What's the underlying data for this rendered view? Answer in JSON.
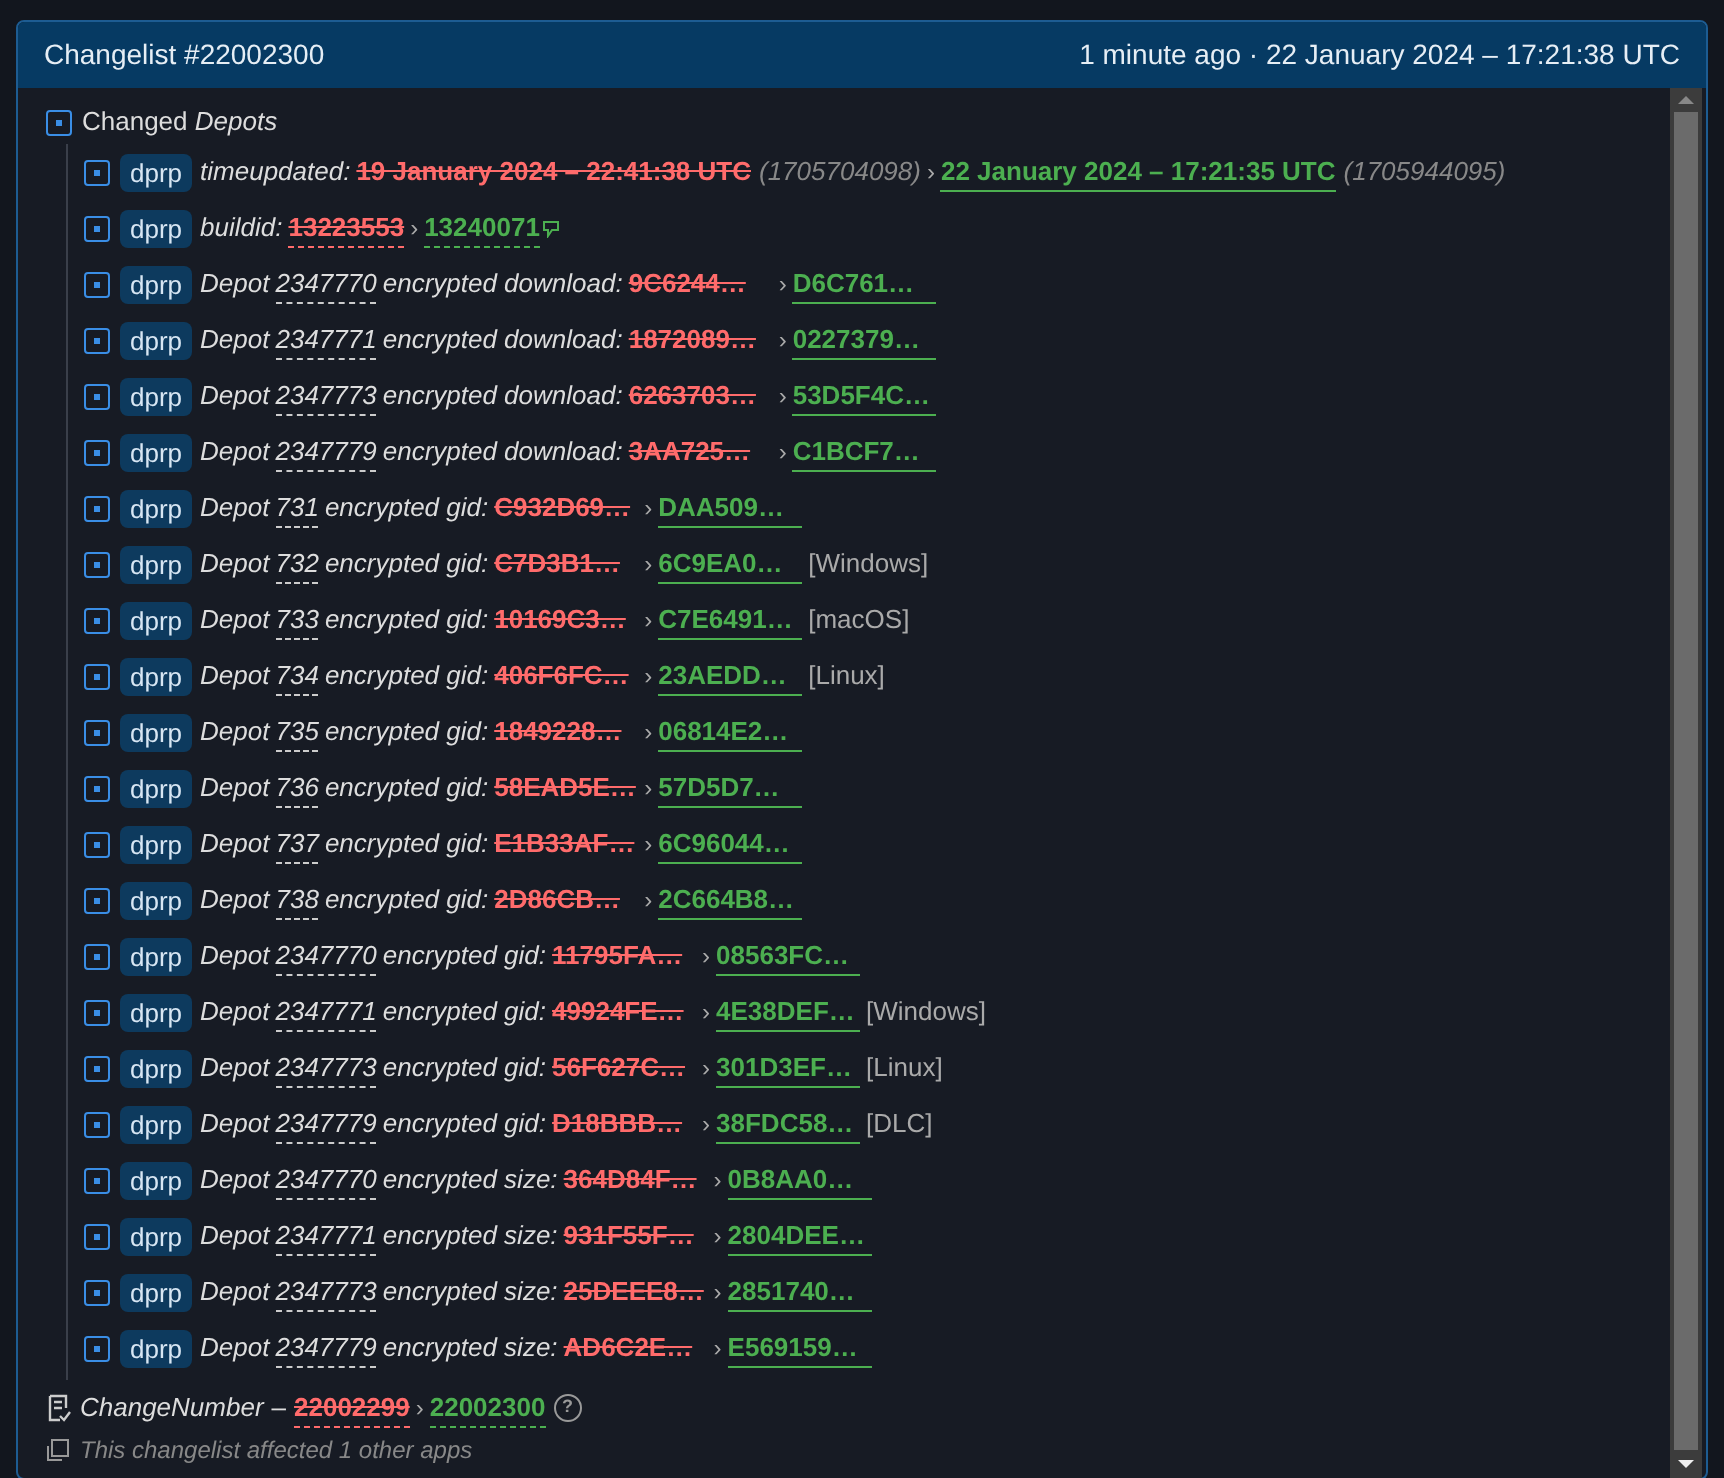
{
  "header": {
    "title": "Changelist #22002300",
    "time": "1 minute ago · 22 January 2024 – 17:21:38 UTC"
  },
  "section": {
    "title_plain": "Changed",
    "title_italic": "Depots",
    "expanded": true
  },
  "changes": [
    {
      "kind": "time",
      "badge": "dprp",
      "key": "timeupdated:",
      "old": "19 January 2024 – 22:41:38 UTC",
      "old_raw": "(1705704098)",
      "arrow": "›",
      "new": "22 January 2024 – 17:21:35 UTC",
      "new_raw": "(1705944095)"
    },
    {
      "kind": "plain",
      "badge": "dprp",
      "key": "buildid:",
      "old": "13223553",
      "arrow": "›",
      "new": "13240071"
    },
    {
      "kind": "depot",
      "badge": "dprp",
      "label": "Depot",
      "depot": "2347770",
      "key": "encrypted download:",
      "old": "9C6244…",
      "arrow": "›",
      "new": "D6C761…"
    },
    {
      "kind": "depot",
      "badge": "dprp",
      "label": "Depot",
      "depot": "2347771",
      "key": "encrypted download:",
      "old": "1872089…",
      "arrow": "›",
      "new": "0227379…"
    },
    {
      "kind": "depot",
      "badge": "dprp",
      "label": "Depot",
      "depot": "2347773",
      "key": "encrypted download:",
      "old": "6263703…",
      "arrow": "›",
      "new": "53D5F4C…"
    },
    {
      "kind": "depot",
      "badge": "dprp",
      "label": "Depot",
      "depot": "2347779",
      "key": "encrypted download:",
      "old": "3AA725…",
      "arrow": "›",
      "new": "C1BCF7…"
    },
    {
      "kind": "depot",
      "badge": "dprp",
      "label": "Depot",
      "depot": "731",
      "key": "encrypted gid:",
      "old": "C932D69…",
      "arrow": "›",
      "new": "DAA509…"
    },
    {
      "kind": "depot",
      "badge": "dprp",
      "label": "Depot",
      "depot": "732",
      "key": "encrypted gid:",
      "old": "C7D3B1…",
      "arrow": "›",
      "new": "6C9EA0…",
      "tag": "[Windows]"
    },
    {
      "kind": "depot",
      "badge": "dprp",
      "label": "Depot",
      "depot": "733",
      "key": "encrypted gid:",
      "old": "10169C3…",
      "arrow": "›",
      "new": "C7E6491…",
      "tag": "[macOS]"
    },
    {
      "kind": "depot",
      "badge": "dprp",
      "label": "Depot",
      "depot": "734",
      "key": "encrypted gid:",
      "old": "406F6FC…",
      "arrow": "›",
      "new": "23AEDD…",
      "tag": "[Linux]"
    },
    {
      "kind": "depot",
      "badge": "dprp",
      "label": "Depot",
      "depot": "735",
      "key": "encrypted gid:",
      "old": "1849228…",
      "arrow": "›",
      "new": "06814E2…"
    },
    {
      "kind": "depot",
      "badge": "dprp",
      "label": "Depot",
      "depot": "736",
      "key": "encrypted gid:",
      "old": "58EAD5E…",
      "arrow": "›",
      "new": "57D5D7…"
    },
    {
      "kind": "depot",
      "badge": "dprp",
      "label": "Depot",
      "depot": "737",
      "key": "encrypted gid:",
      "old": "E1B33AF…",
      "arrow": "›",
      "new": "6C96044…"
    },
    {
      "kind": "depot",
      "badge": "dprp",
      "label": "Depot",
      "depot": "738",
      "key": "encrypted gid:",
      "old": "2D86CB…",
      "arrow": "›",
      "new": "2C664B8…"
    },
    {
      "kind": "depot",
      "badge": "dprp",
      "label": "Depot",
      "depot": "2347770",
      "key": "encrypted gid:",
      "old": "11795FA…",
      "arrow": "›",
      "new": "08563FC…"
    },
    {
      "kind": "depot",
      "badge": "dprp",
      "label": "Depot",
      "depot": "2347771",
      "key": "encrypted gid:",
      "old": "49924FE…",
      "arrow": "›",
      "new": "4E38DEF…",
      "tag": "[Windows]"
    },
    {
      "kind": "depot",
      "badge": "dprp",
      "label": "Depot",
      "depot": "2347773",
      "key": "encrypted gid:",
      "old": "56F627C…",
      "arrow": "›",
      "new": "301D3EF…",
      "tag": "[Linux]"
    },
    {
      "kind": "depot",
      "badge": "dprp",
      "label": "Depot",
      "depot": "2347779",
      "key": "encrypted gid:",
      "old": "D18BBB…",
      "arrow": "›",
      "new": "38FDC58…",
      "tag": "[DLC]"
    },
    {
      "kind": "depot",
      "badge": "dprp",
      "label": "Depot",
      "depot": "2347770",
      "key": "encrypted size:",
      "old": "364D84F…",
      "arrow": "›",
      "new": "0B8AA0…"
    },
    {
      "kind": "depot",
      "badge": "dprp",
      "label": "Depot",
      "depot": "2347771",
      "key": "encrypted size:",
      "old": "931F55F…",
      "arrow": "›",
      "new": "2804DEE…"
    },
    {
      "kind": "depot",
      "badge": "dprp",
      "label": "Depot",
      "depot": "2347773",
      "key": "encrypted size:",
      "old": "25DEEE8…",
      "arrow": "›",
      "new": "2851740…"
    },
    {
      "kind": "depot",
      "badge": "dprp",
      "label": "Depot",
      "depot": "2347779",
      "key": "encrypted size:",
      "old": "AD6C2E…",
      "arrow": "›",
      "new": "E569159…"
    }
  ],
  "change_number": {
    "label": "ChangeNumber",
    "dash": "–",
    "old": "22002299",
    "arrow": "›",
    "new": "22002300",
    "help": "?"
  },
  "footer_note": "This changelist affected 1 other apps"
}
